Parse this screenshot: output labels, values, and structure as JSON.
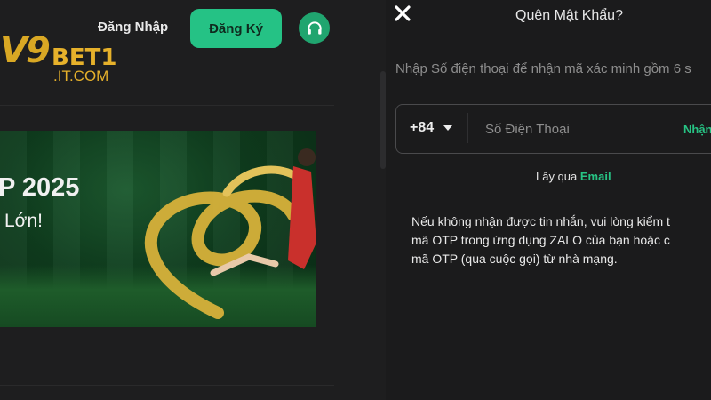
{
  "header": {
    "logo": {
      "mark": "V9",
      "brand": "BET1",
      "sub": ".IT.COM"
    },
    "login_label": "Đăng Nhập",
    "register_label": "Đăng Ký",
    "support_icon": "headset-icon"
  },
  "banner": {
    "line1": "P 2025",
    "line2": "Lớn!"
  },
  "modal": {
    "close_icon": "close-icon",
    "title": "Quên Mật Khẩu?",
    "instructions": "Nhập Số điện thoại để nhận mã xác minh gồm 6 s",
    "country_code": "+84",
    "phone_placeholder": "Số Điện Thoại",
    "send_label": "Nhận",
    "alt_prefix": "Lấy qua",
    "alt_link": "Email",
    "note_lines": [
      "Nếu không nhận được tin nhắn, vui lòng kiểm t",
      "mã OTP trong ứng dụng ZALO của bạn hoặc c",
      "mã OTP (qua cuộc gọi) từ nhà mạng."
    ]
  },
  "colors": {
    "accent": "#25c285",
    "logo_gold": "#e6b12b",
    "background": "#1e1e1f"
  }
}
